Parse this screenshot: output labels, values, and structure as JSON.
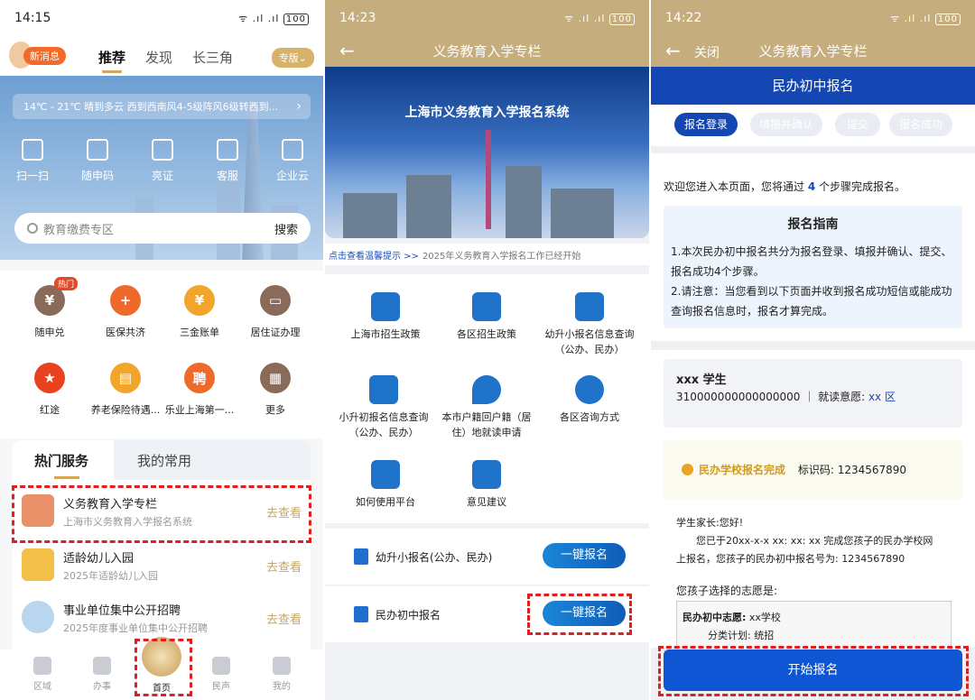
{
  "panel1": {
    "status": {
      "time": "14:15",
      "signal": "ᯤ .ıl .ıl",
      "battery": "100"
    },
    "header": {
      "msg_badge": "新消息",
      "tabs": [
        "推荐",
        "发现",
        "长三角"
      ],
      "special": "专版⌄"
    },
    "weather": "14℃ - 21℃  晴到多云  西到西南风4-5级阵风6级转西到...",
    "quick_actions": [
      "扫一扫",
      "随申码",
      "亮证",
      "客服",
      "企业云"
    ],
    "search": {
      "placeholder": "教育缴费专区",
      "button": "搜索"
    },
    "services_row1": [
      "随申兑",
      "医保共济",
      "三金账单",
      "居住证办理"
    ],
    "services_row2": [
      "红途",
      "养老保险待遇...",
      "乐业上海第一...",
      "更多"
    ],
    "hot_badge": "热门",
    "service_tabs": {
      "active": "热门服务",
      "inactive": "我的常用"
    },
    "list": [
      {
        "title": "义务教育入学专栏",
        "subtitle": "上海市义务教育入学报名系统",
        "action": "去查看"
      },
      {
        "title": "适龄幼儿入园",
        "subtitle": "2025年适龄幼儿入园",
        "action": "去查看"
      },
      {
        "title": "事业单位集中公开招聘",
        "subtitle": "2025年度事业单位集中公开招聘",
        "action": "去查看"
      }
    ],
    "bottom_nav": [
      "区域",
      "办事",
      "首页",
      "民声",
      "我的"
    ]
  },
  "panel2": {
    "status": {
      "time": "14:23",
      "signal": "ᯤ .ıl .ıl",
      "battery": "100"
    },
    "title": "义务教育入学专栏",
    "banner_title": "上海市义务教育入学报名系统",
    "ticker_link": "点击查看温馨提示 >>",
    "ticker_text": "2025年义务教育入学报名工作已经开始",
    "grid": [
      [
        "上海市招生政策"
      ],
      [
        "各区招生政策"
      ],
      [
        "幼升小报名信息查询",
        "（公办、民办）"
      ],
      [
        "小升初报名信息查询",
        "（公办、民办）"
      ],
      [
        "本市户籍回户籍（居",
        "住）地就读申请"
      ],
      [
        "各区咨询方式"
      ],
      [
        "如何使用平台"
      ],
      [
        "意见建议"
      ]
    ],
    "reg_rows": [
      {
        "label": "幼升小报名(公办、民办)",
        "button": "一键报名"
      },
      {
        "label": "民办初中报名",
        "button": "一键报名"
      }
    ]
  },
  "panel3": {
    "status": {
      "time": "14:22",
      "signal": "ᯤ .ıl .ıl",
      "battery": "100"
    },
    "close": "关闭",
    "title": "义务教育入学专栏",
    "subtitle": "民办初中报名",
    "steps": [
      "报名登录",
      "填报并确认",
      "提交",
      "报名成功"
    ],
    "welcome_pre": "欢迎您进入本页面，您将通过",
    "welcome_num": "4",
    "welcome_post": "个步骤完成报名。",
    "guide_title": "报名指南",
    "guide_p1": "1.本次民办初中报名共分为报名登录、填报并确认、提交、报名成功4个步骤。",
    "guide_p2": "2.请注意：当您看到以下页面并收到报名成功短信或能成功查询报名信息时，报名才算完成。",
    "student_name": "xxx 学生",
    "student_id": "310000000000000000",
    "intent_label": "就读意愿:",
    "intent_value": "xx 区",
    "done_text": "民办学校报名完成",
    "code_label": "标识码:",
    "code_value": "1234567890",
    "letter_greet": "学生家长:您好!",
    "letter_body1": "您已于20xx-x-x xx:  xx:  xx 完成您孩子的民办学校网",
    "letter_body2": "上报名，您孩子的民办初中报名号为: 1234567890",
    "choice_label": "您孩子选择的志愿是:",
    "choice_key": "民办初中志愿:",
    "choice_val": "xx学校",
    "plan_key": "分类计划:",
    "plan_val": "统招",
    "start_button": "开始报名"
  }
}
